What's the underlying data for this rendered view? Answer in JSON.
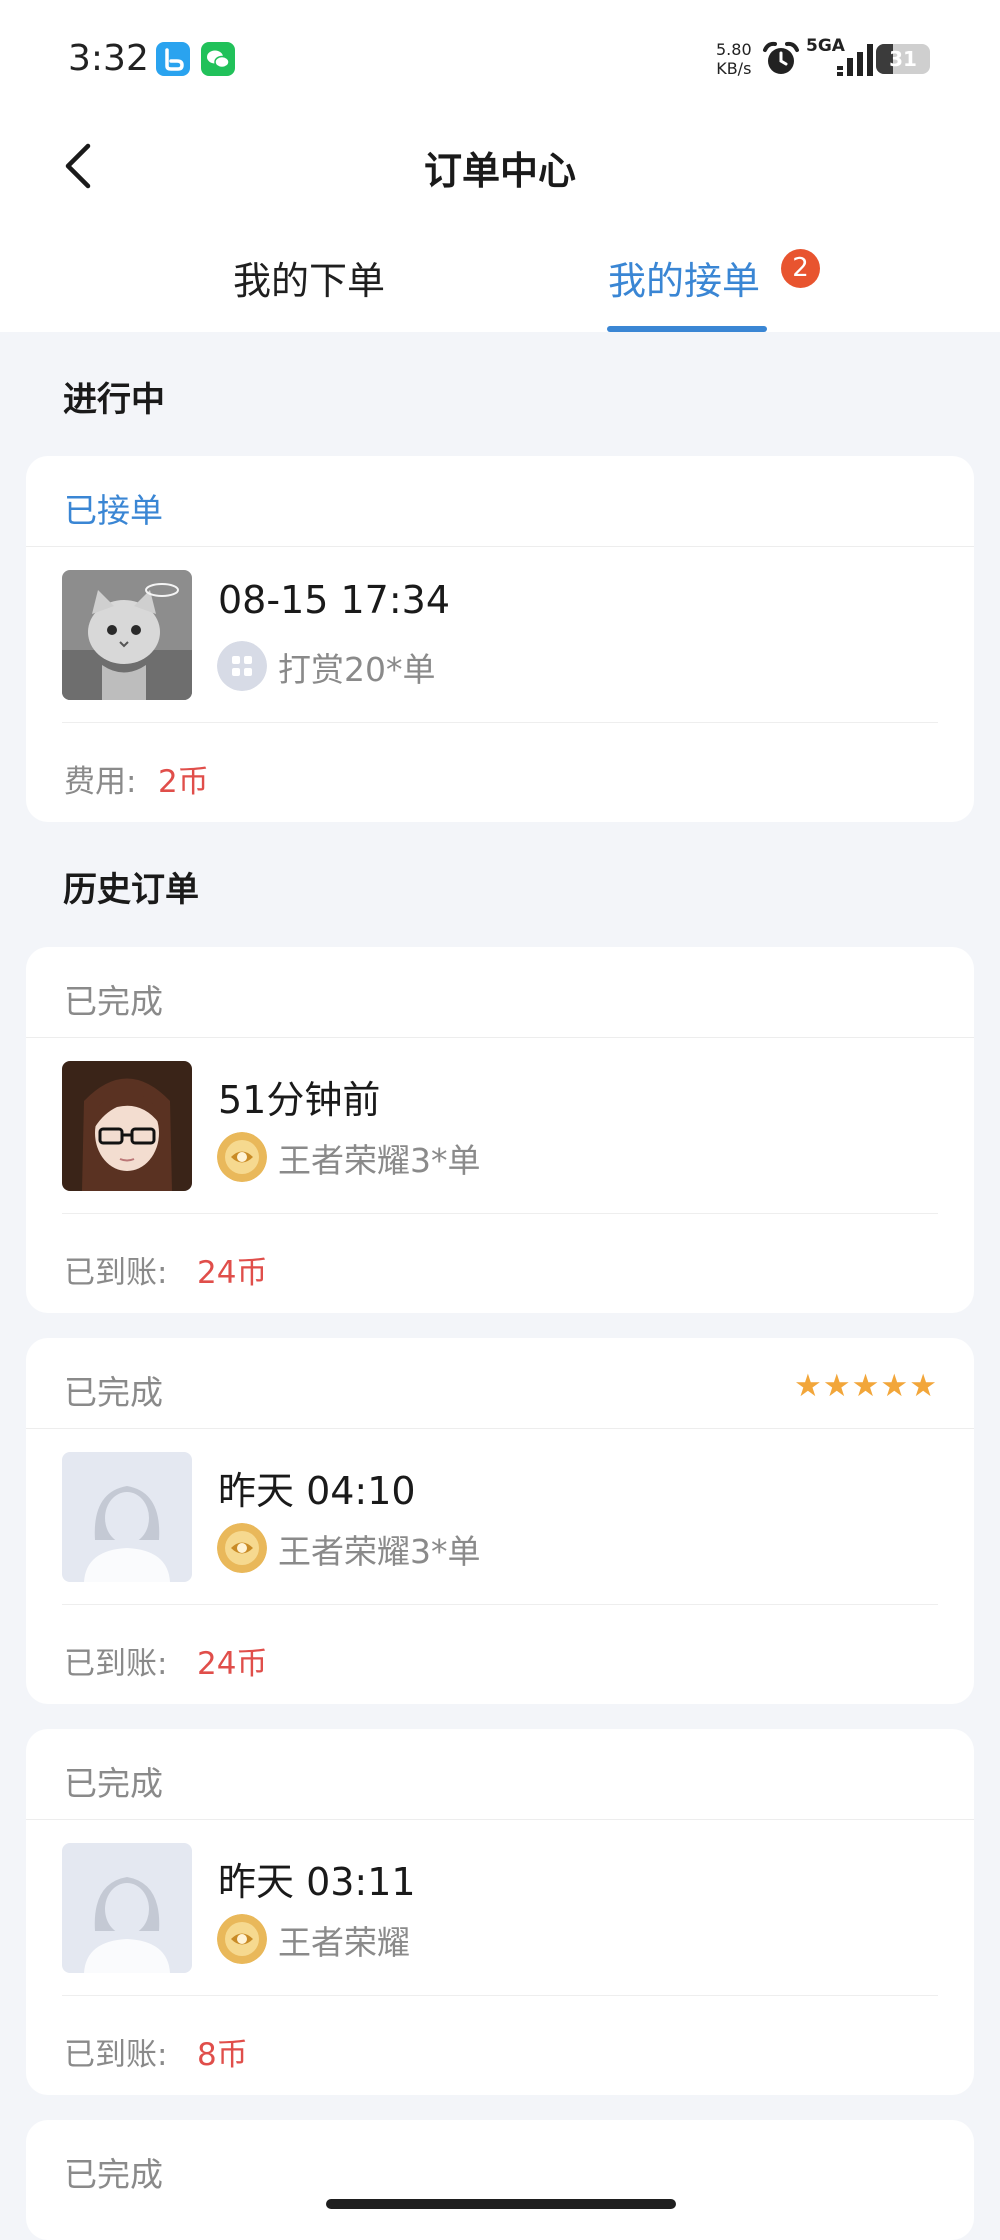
{
  "status_bar": {
    "time": "3:32",
    "net_speed_value": "5.80",
    "net_speed_unit": "KB/s",
    "network": "5GA",
    "battery": "31",
    "battery_level": 0.31
  },
  "header": {
    "title": "订单中心",
    "tabs": [
      {
        "label": "我的下单",
        "active": false
      },
      {
        "label": "我的接单",
        "active": true,
        "badge": "2"
      }
    ]
  },
  "ongoing": {
    "section_title": "进行中",
    "orders": [
      {
        "status": "已接单",
        "time": "08-15 17:34",
        "game": "打赏20*单",
        "fee_label": "费用:",
        "fee": "2币"
      }
    ]
  },
  "history": {
    "section_title": "历史订单",
    "orders": [
      {
        "status": "已完成",
        "time": "51分钟前",
        "game": "王者荣耀3*单",
        "fee_label": "已到账:",
        "fee": "24币"
      },
      {
        "status": "已完成",
        "rating": 5,
        "time": "昨天 04:10",
        "game": "王者荣耀3*单",
        "fee_label": "已到账:",
        "fee": "24币"
      },
      {
        "status": "已完成",
        "time": "昨天 03:11",
        "game": "王者荣耀",
        "fee_label": "已到账:",
        "fee": "8币"
      },
      {
        "status": "已完成"
      }
    ]
  },
  "colors": {
    "accent": "#3a86d4",
    "badge": "#e8542f",
    "price": "#e04e4a",
    "star": "#f2a63a",
    "background": "#f3f5f9"
  },
  "icons": {
    "back": "chevron-left-icon",
    "alarm": "alarm-clock-icon",
    "signal": "signal-bars-icon",
    "battery": "battery-icon",
    "reward_game": "grid-apps-icon",
    "honor_game": "honor-of-kings-icon",
    "rating": "star-icon"
  }
}
